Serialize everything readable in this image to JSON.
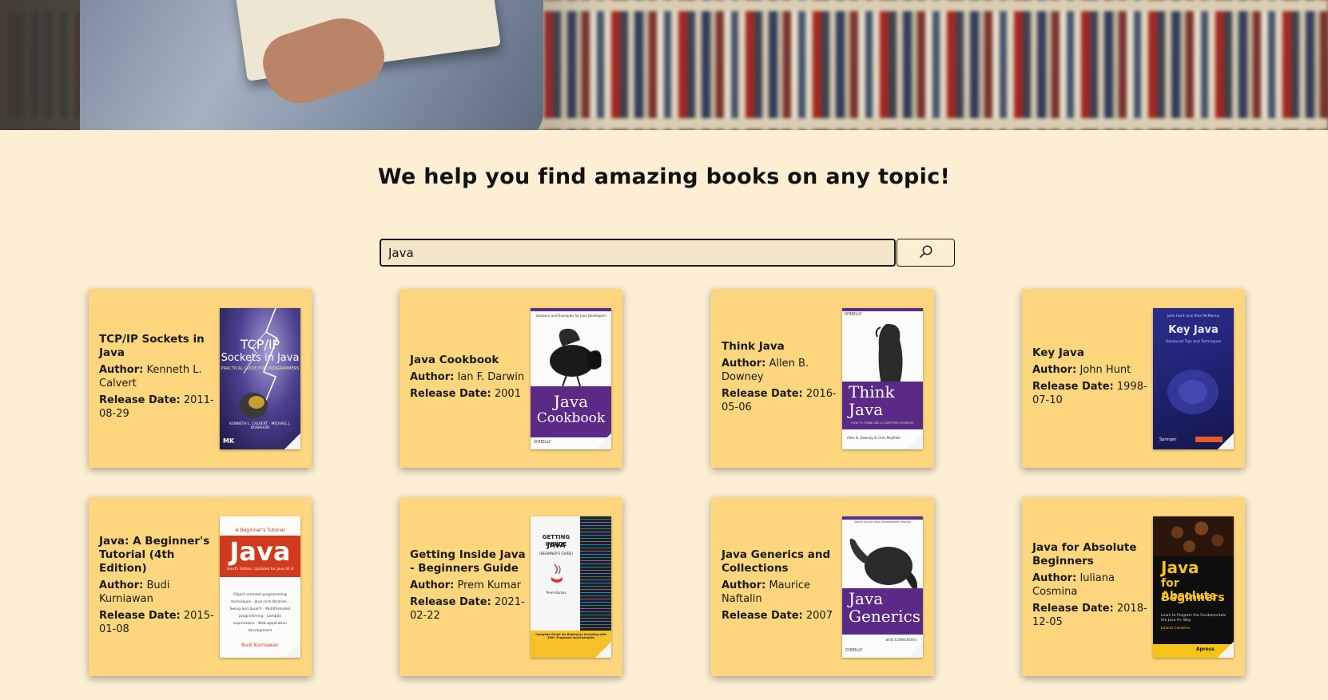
{
  "hero": {
    "image_name": "person-holding-book-in-library"
  },
  "headline": "We help you find amazing books on any topic!",
  "search": {
    "value": "Java",
    "button_icon": "search-icon"
  },
  "labels": {
    "author": "Author:",
    "release": "Release Date:"
  },
  "books": [
    {
      "title": "TCP/IP Sockets in Java",
      "author": "Kenneth L. Calvert",
      "release": "2011-08-29",
      "cover": {
        "line1": "TCP/IP",
        "line2": "Sockets in Java",
        "sub": "PRACTICAL GUIDE FOR PROGRAMMERS",
        "authors": "KENNETH L. CALVERT · MICHAEL J. DONAHOO",
        "publisher": "MK"
      }
    },
    {
      "title": "Java Cookbook",
      "author": "Ian F. Darwin",
      "release": "2001",
      "cover": {
        "top": "Solutions and Examples for Java Developers",
        "line1": "Java",
        "line2": "Cookbook",
        "publisher": "O'REILLY"
      }
    },
    {
      "title": "Think Java",
      "author": "Allen B. Downey",
      "release": "2016-05-06",
      "cover": {
        "top": "O'REILLY",
        "line1": "Think",
        "line2": "Java",
        "sub": "HOW TO THINK LIKE A COMPUTER SCIENTIST",
        "authors": "Allen B. Downey & Chris Mayfield"
      }
    },
    {
      "title": "Key Java",
      "author": "John Hunt",
      "release": "1998-07-10",
      "cover": {
        "top": "John Hunt and Alex McManus",
        "line1": "Key Java",
        "sub": "Advanced Tips and Techniques",
        "publisher": "Springer"
      }
    },
    {
      "title": "Java: A Beginner's Tutorial (4th Edition)",
      "author": "Budi Kurniawan",
      "release": "2015-01-08",
      "cover": {
        "top": "A Beginner's Tutorial",
        "line1": "Java",
        "sub": "Fourth Edition, Updated for Java SE 8",
        "bullets": "Object oriented programming techniques · Java core libraries · Swing and JavaFX · Multithreaded programming · Lambda expressions · Web application development",
        "authors": "Budi Kurniawan"
      }
    },
    {
      "title": "Getting Inside Java - Beginners Guide",
      "author": "Prem Kumar",
      "release": "2021-02-22",
      "cover": {
        "line1": "GETTING INSIDE",
        "line2": "JAVA",
        "sub": "(BEGINNER'S GUIDE)",
        "authors": "Prem Kumar",
        "band": "Complete Guide for Beginners including with 200+ Programs and Examples"
      }
    },
    {
      "title": "Java Generics and Collections",
      "author": "Maurice Naftalin",
      "release": "2007",
      "cover": {
        "top": "Speed Up the Java Development Process",
        "line1": "Java",
        "line2": "Generics",
        "sub": "and Collections",
        "publisher": "O'REILLY"
      }
    },
    {
      "title": "Java for Absolute Beginners",
      "author": "Iuliana Cosmina",
      "release": "2018-12-05",
      "cover": {
        "line1": "Java",
        "line2": "for Absolute",
        "line3": "Beginners",
        "sub": "Learn to Program the Fundamentals the Java 9+ Way",
        "authors": "Iuliana Cosmina",
        "publisher": "Apress"
      }
    }
  ]
}
